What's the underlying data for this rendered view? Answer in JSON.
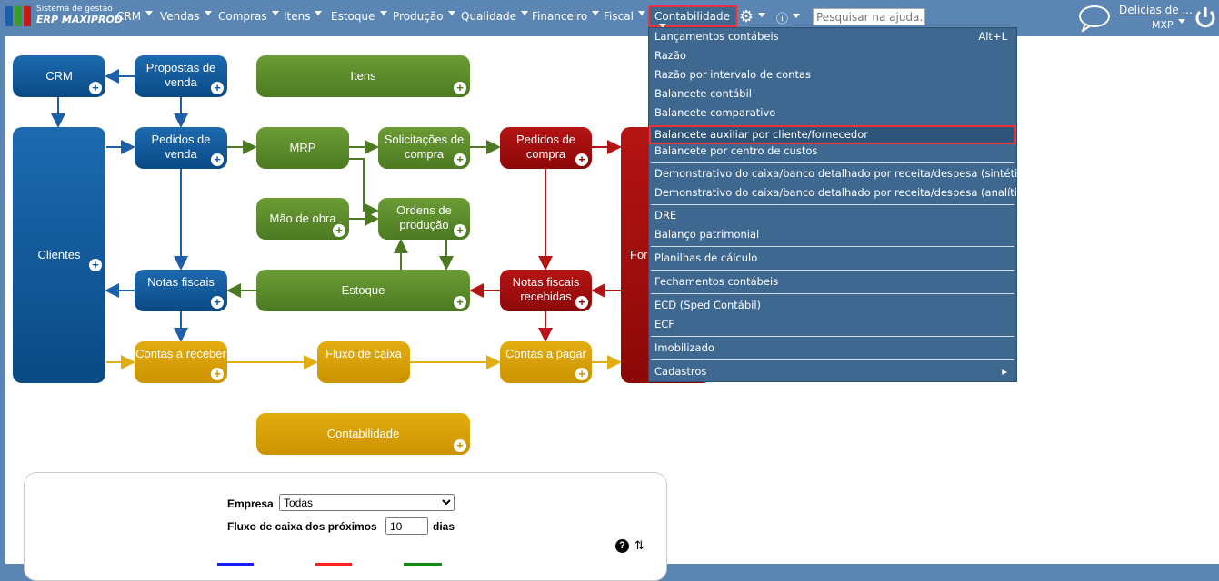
{
  "header": {
    "logo_line1": "Sistema de gestão",
    "logo_line2": "ERP MAXIPROD",
    "nav": [
      "CRM",
      "Vendas",
      "Compras",
      "Itens",
      "Estoque",
      "Produção",
      "Qualidade",
      "Financeiro",
      "Fiscal"
    ],
    "active_menu": "Contabilidade",
    "search_placeholder": "Pesquisar na ajuda...",
    "company": "Delicias de ...",
    "user": "MXP"
  },
  "menu": {
    "items": [
      {
        "label": "Lançamentos contábeis",
        "shortcut": "Alt+L"
      },
      {
        "label": "Razão"
      },
      {
        "label": "Razão por intervalo de contas"
      },
      {
        "label": "Balancete contábil"
      },
      {
        "label": "Balancete comparativo"
      },
      {
        "label": "Balancete auxiliar por cliente/fornecedor"
      },
      {
        "label": "Balancete por centro de custos"
      },
      {
        "label": "Demonstrativo do caixa/banco detalhado por receita/despesa (sintético)"
      },
      {
        "label": "Demonstrativo do caixa/banco detalhado por receita/despesa (analítico)"
      },
      {
        "label": "DRE"
      },
      {
        "label": "Balanço patrimonial"
      },
      {
        "label": "Planilhas de cálculo"
      },
      {
        "label": "Fechamentos contábeis"
      },
      {
        "label": "ECD (Sped Contábil)"
      },
      {
        "label": "ECF"
      },
      {
        "label": "Imobilizado"
      },
      {
        "label": "Cadastros"
      }
    ]
  },
  "diagram": {
    "crm": "CRM",
    "propostas": "Propostas de venda",
    "itens": "Itens",
    "clientes": "Clientes",
    "pedidos_venda": "Pedidos de venda",
    "mrp": "MRP",
    "solicitacoes": "Solicitações de compra",
    "pedidos_compra": "Pedidos de compra",
    "fornecedores": "For",
    "mao_obra": "Mão de obra",
    "ordens": "Ordens de produção",
    "notas": "Notas fiscais",
    "estoque": "Estoque",
    "notas_recebidas": "Notas fiscais recebidas",
    "contas_receber": "Contas a receber",
    "fluxo": "Fluxo de caixa",
    "contas_pagar": "Contas a pagar",
    "contabilidade": "Contabilidade"
  },
  "panel": {
    "empresa_label": "Empresa",
    "empresa_value": "Todas",
    "fluxo_label": "Fluxo de caixa dos próximos",
    "fluxo_value": "10",
    "dias_label": "dias"
  },
  "colors": {
    "blue": "#0d5799",
    "green": "#5b8a2a",
    "red": "#a50e0e",
    "gold": "#d8a300"
  }
}
